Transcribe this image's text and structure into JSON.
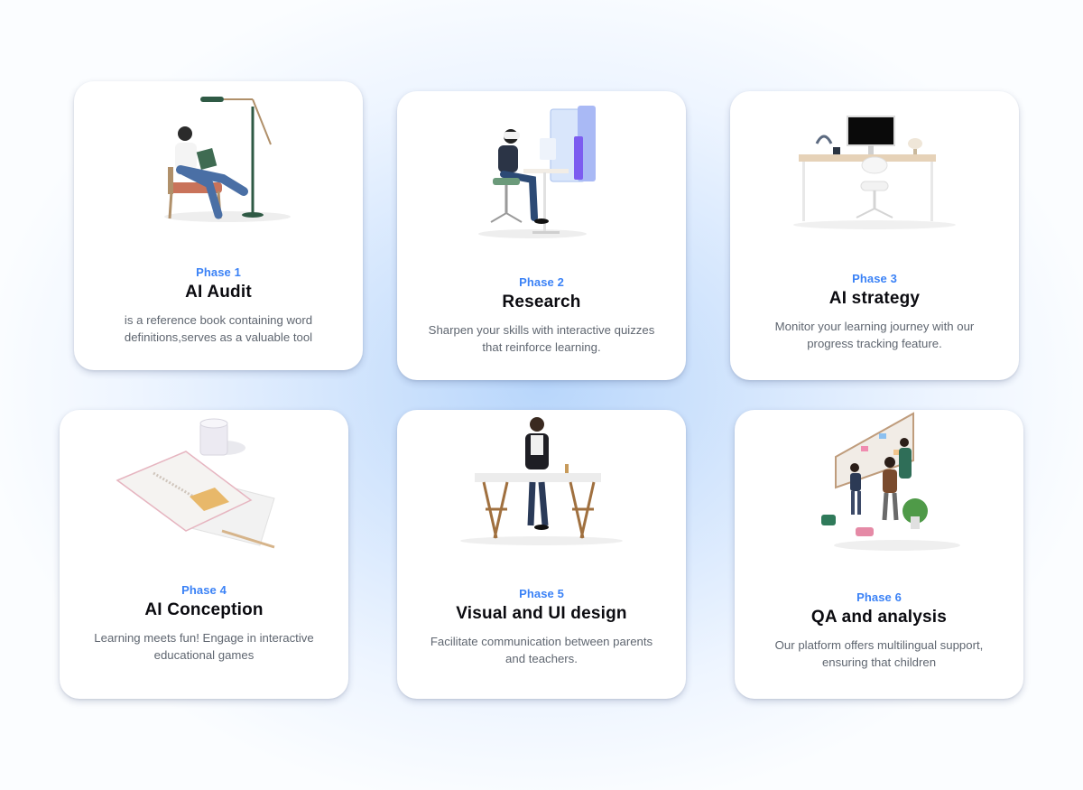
{
  "phases": [
    {
      "label": "Phase 1",
      "title": "AI Audit",
      "description": "is a reference book containing word definitions,serves as a valuable tool",
      "illustration": "woman-reading-in-chair"
    },
    {
      "label": "Phase 2",
      "title": "Research",
      "description": "Sharpen your skills with interactive quizzes that reinforce learning.",
      "illustration": "vr-headset-desk"
    },
    {
      "label": "Phase 3",
      "title": "AI strategy",
      "description": "Monitor your learning journey with our progress tracking feature.",
      "illustration": "empty-desk-with-monitor"
    },
    {
      "label": "Phase 4",
      "title": "AI Conception",
      "description": "Learning meets fun! Engage in interactive educational games",
      "illustration": "notebook-and-cup"
    },
    {
      "label": "Phase 5",
      "title": "Visual and UI design",
      "description": "Facilitate communication between parents and teachers.",
      "illustration": "woman-at-trestle-table"
    },
    {
      "label": "Phase 6",
      "title": "QA and analysis",
      "description": "Our platform offers multilingual support, ensuring that children",
      "illustration": "team-at-whiteboard"
    }
  ],
  "colors": {
    "accent": "#3b82f6",
    "title": "#0b0b10",
    "body_text": "#5f6670",
    "card": "#ffffff"
  }
}
